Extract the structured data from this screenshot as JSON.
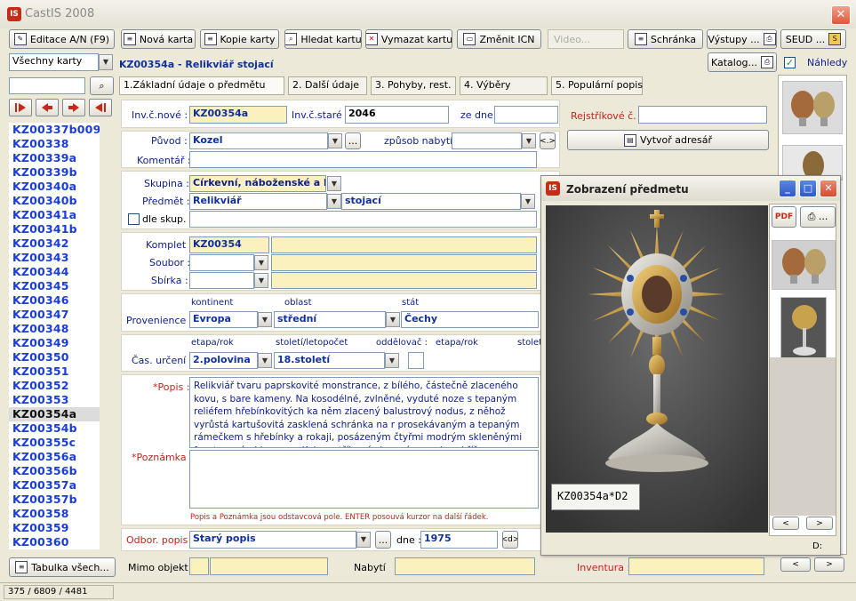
{
  "window": {
    "title": "CastIS 2008",
    "icon": "app-castis-icon"
  },
  "toolbar": {
    "editace": "Editace A/N (F9)",
    "nova": "Nová karta",
    "kopie": "Kopie karty",
    "hledat": "Hledat kartu",
    "vymazat": "Vymazat kartu",
    "zmenit": "Změnit ICN",
    "video": "Video...",
    "schranka": "Schránka",
    "vystupy": "Výstupy ...",
    "seud": "SEUD ...",
    "katalog": "Katalog...",
    "nahledy": "Náhledy"
  },
  "filter": {
    "selected": "Všechny karty",
    "search_value": ""
  },
  "record": {
    "header": "KZ00354a - Relikviář stojací"
  },
  "tabs": [
    {
      "label": "1.Základní údaje o předmětu"
    },
    {
      "label": "2. Další údaje"
    },
    {
      "label": "3. Pohyby, rest."
    },
    {
      "label": "4. Výběry"
    },
    {
      "label": "5. Populární popis"
    }
  ],
  "list": [
    "KZ00337b009",
    "KZ00338",
    "KZ00339a",
    "KZ00339b",
    "KZ00340a",
    "KZ00340b",
    "KZ00341a",
    "KZ00341b",
    "KZ00342",
    "KZ00343",
    "KZ00344",
    "KZ00345",
    "KZ00346",
    "KZ00347",
    "KZ00348",
    "KZ00349",
    "KZ00350",
    "KZ00351",
    "KZ00352",
    "KZ00353",
    "KZ00354a",
    "KZ00354b",
    "KZ00355c",
    "KZ00356a",
    "KZ00356b",
    "KZ00357a",
    "KZ00357b",
    "KZ00358",
    "KZ00359",
    "KZ00360"
  ],
  "list_selected": "KZ00354a",
  "tabulka": "Tabulka všech...",
  "status": "375 / 6809 / 4481",
  "form": {
    "inv_nove_label": "Inv.č.nové :",
    "inv_nove": "KZ00354a",
    "inv_stare_label": "Inv.č.staré :",
    "inv_stare": "2046",
    "ze_dne_label": "ze dne",
    "ze_dne": "",
    "rejstrik_label": "Rejstříkové č. :",
    "rejstrik": "",
    "adresar_btn": "Vytvoř adresář",
    "puvod_label": "Původ :",
    "puvod": "Kozel",
    "zpusob_label": "způsob nabytí :",
    "zpusob": "",
    "komentar_label": "Komentář :",
    "komentar": "",
    "skupina_label": "Skupina :",
    "skupina": "Církevní, náboženské a ku",
    "predmet_label": "Předmět :",
    "predmet": "Relikviář",
    "predmet2": "stojací",
    "dle_skup": "dle skup.",
    "komplet_label": "Komplet :",
    "komplet": "KZ00354",
    "soubor_label": "Soubor :",
    "sbirka_label": "Sbírka :",
    "kontinent_h": "kontinent",
    "oblast_h": "oblast",
    "stat_h": "stát",
    "provenience_label": "Provenience :",
    "kontinent": "Evropa",
    "oblast": "střední",
    "stat": "Čechy",
    "etapa_h": "etapa/rok",
    "stoleti_h": "století/letopočet",
    "oddelovac_h": "oddělovač :",
    "etapa2_h": "etapa/rok",
    "stolet2_h": "stolet",
    "cas_label": "Čas. určení :",
    "etapa": "2.polovina",
    "stoleti": "18.století",
    "popis_label": "*Popis :",
    "popis": "Relikviář tvaru paprskovité monstrance, z bílého, částečně zlaceného kovu, s bare kameny. Na kosodélné, zvlněné, vyduté noze s tepaným reliéfem hřebínkovitých ka něm zlacený balustrový nodus, z něhož vyrůstá kartušovitá zasklená schránka na r prosekávaným a tepaným rámečkem s hřebínky a rokaji, posázeným čtyřmi modrým skleněnými fasetovanými kameny. Kolem stříhané zlacené paprsky s křížem ve vrc",
    "poznamka_label": "*Poznámka :",
    "poznamka": "",
    "hint": "Popis a Poznámka jsou odstavcová pole. ENTER posouvá kurzor na další řádek.",
    "odbor_label": "Odbor. popis :",
    "odbor": "Starý popis",
    "dne_label": "dne :",
    "dne": "1975",
    "mimo_label": "Mimo objekt",
    "nabyti_label": "Nabytí",
    "inventura_label": "Inventura :"
  },
  "popup": {
    "title": "Zobrazení předmetu",
    "photo_label": "KZ00354a*D2",
    "status_label": "D:"
  },
  "colors": {
    "accent": "#10309a",
    "list_blue": "#1a3ed0",
    "required_red": "#b8281c",
    "yellow_field": "#fbf1be"
  }
}
